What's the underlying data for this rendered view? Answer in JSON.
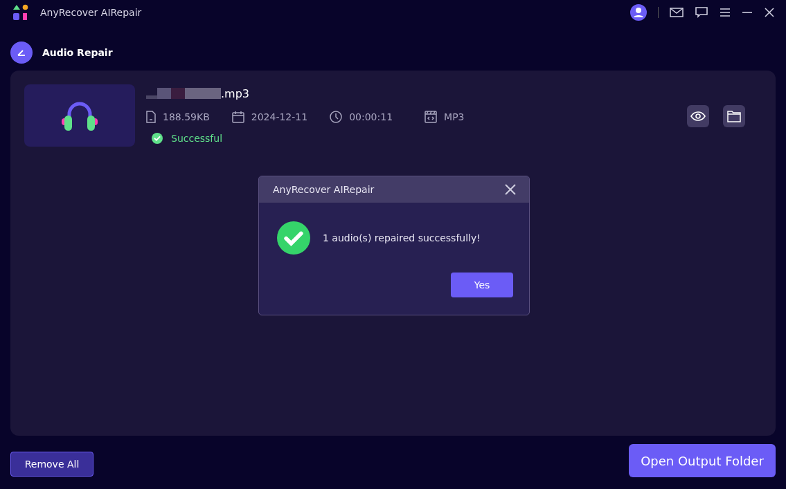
{
  "window": {
    "title": "AnyRecover AIRepair"
  },
  "header": {
    "title": "Audio Repair"
  },
  "file": {
    "name": ".mp3",
    "size": "188.59KB",
    "date": "2024-12-11",
    "duration": "00:00:11",
    "format": "MP3",
    "status": {
      "kind": "success",
      "text": "Successful"
    }
  },
  "dialog": {
    "title": "AnyRecover AIRepair",
    "message": "1 audio(s) repaired successfully!",
    "kind": "success",
    "button": "Yes"
  },
  "footer": {
    "remove_button": "Remove All",
    "open_button": "Open Output Folder"
  }
}
